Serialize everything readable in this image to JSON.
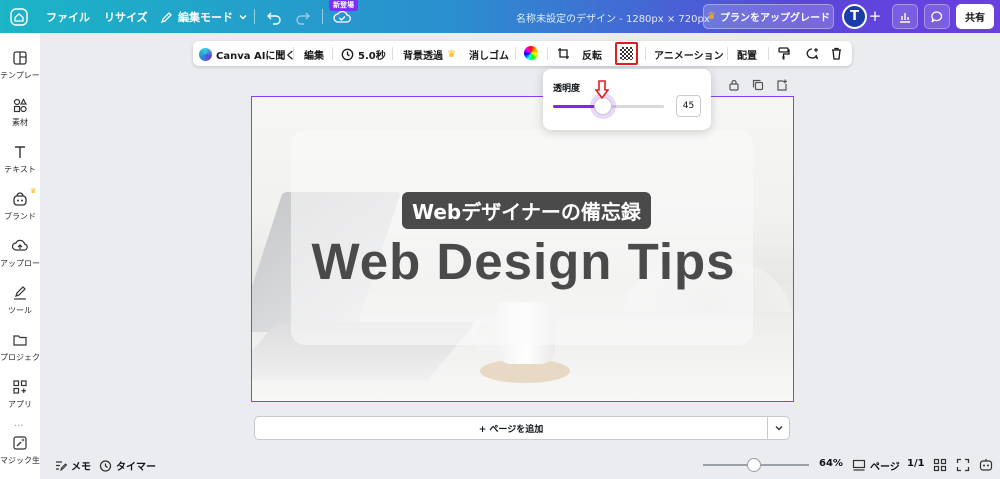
{
  "topbar": {
    "file": "ファイル",
    "resize": "リサイズ",
    "edit_mode": "編集モード",
    "new_badge": "新登場",
    "doc_title": "名称未設定のデザイン - 1280px × 720px",
    "upgrade": "プランをアップグレード",
    "avatar_letter": "T",
    "share": "共有"
  },
  "sidebar": {
    "items": [
      {
        "label": "テンプレート",
        "icon": "template-icon"
      },
      {
        "label": "素材",
        "icon": "elements-icon"
      },
      {
        "label": "テキスト",
        "icon": "text-icon"
      },
      {
        "label": "ブランド",
        "icon": "brand-icon"
      },
      {
        "label": "アップロード",
        "icon": "upload-icon"
      },
      {
        "label": "ツール",
        "icon": "draw-icon"
      },
      {
        "label": "プロジェクト",
        "icon": "folder-icon"
      },
      {
        "label": "アプリ",
        "icon": "apps-icon"
      },
      {
        "label": "マジック生成",
        "icon": "magic-icon"
      }
    ]
  },
  "context_toolbar": {
    "canva_ai": "Canva AIに聞く",
    "edit": "編集",
    "duration": "5.0秒",
    "bg_remove": "背景透過",
    "eraser": "消しゴム",
    "flip": "反転",
    "animation": "アニメーション",
    "position": "配置"
  },
  "transparency": {
    "label": "透明度",
    "value": 45,
    "value_text": "45"
  },
  "canvas": {
    "subtitle": "Webデザイナーの備忘録",
    "title": "Web Design Tips"
  },
  "add_page": "+ ページを追加",
  "bottombar": {
    "notes": "メモ",
    "timer": "タイマー",
    "zoom": "64%",
    "pages": "ページ",
    "page_count": "1/1"
  },
  "colors": {
    "accent": "#8b3dff",
    "highlight": "#e02020"
  }
}
